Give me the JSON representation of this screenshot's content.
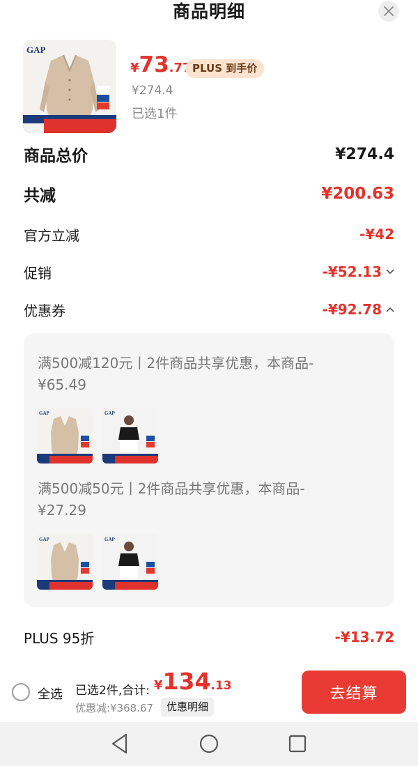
{
  "header": {
    "title": "商品明细"
  },
  "product": {
    "brand_logo": "GAP",
    "price_symbol": "¥",
    "price_int": "73",
    "price_dec": ".77",
    "plus_badge": "PLUS 到手价",
    "original_price": "¥274.4",
    "selected": "已选1件"
  },
  "summary": {
    "total_label": "商品总价",
    "total_value": "¥274.4",
    "reduce_label": "共减",
    "reduce_value": "¥200.63",
    "official_label": "官方立减",
    "official_value": "-¥42",
    "promo_label": "促销",
    "promo_value": "-¥52.13",
    "coupon_label": "优惠券",
    "coupon_value": "-¥92.78",
    "plus_label": "PLUS 95折",
    "plus_value": "-¥13.72"
  },
  "coupons": [
    {
      "text": "满500减120元丨2件商品共享优惠，本商品-¥65.49"
    },
    {
      "text": "满500减50元丨2件商品共享优惠，本商品-¥27.29"
    }
  ],
  "bottom": {
    "select_all": "全选",
    "total_label": "已选2件,合计:",
    "total_symbol": "¥",
    "total_int": "134",
    "total_dec": ".13",
    "discount_note": "优惠减:¥368.67",
    "detail_button": "优惠明细",
    "checkout_button": "去结算"
  },
  "colors": {
    "accent": "#e4322b",
    "plus_badge_bg": "#fbe3cf",
    "checkout_bg": "#e93b33"
  },
  "icons": [
    "close-icon",
    "chevron-down-icon",
    "chevron-up-icon",
    "nav-back-icon",
    "nav-home-icon",
    "nav-recents-icon"
  ]
}
